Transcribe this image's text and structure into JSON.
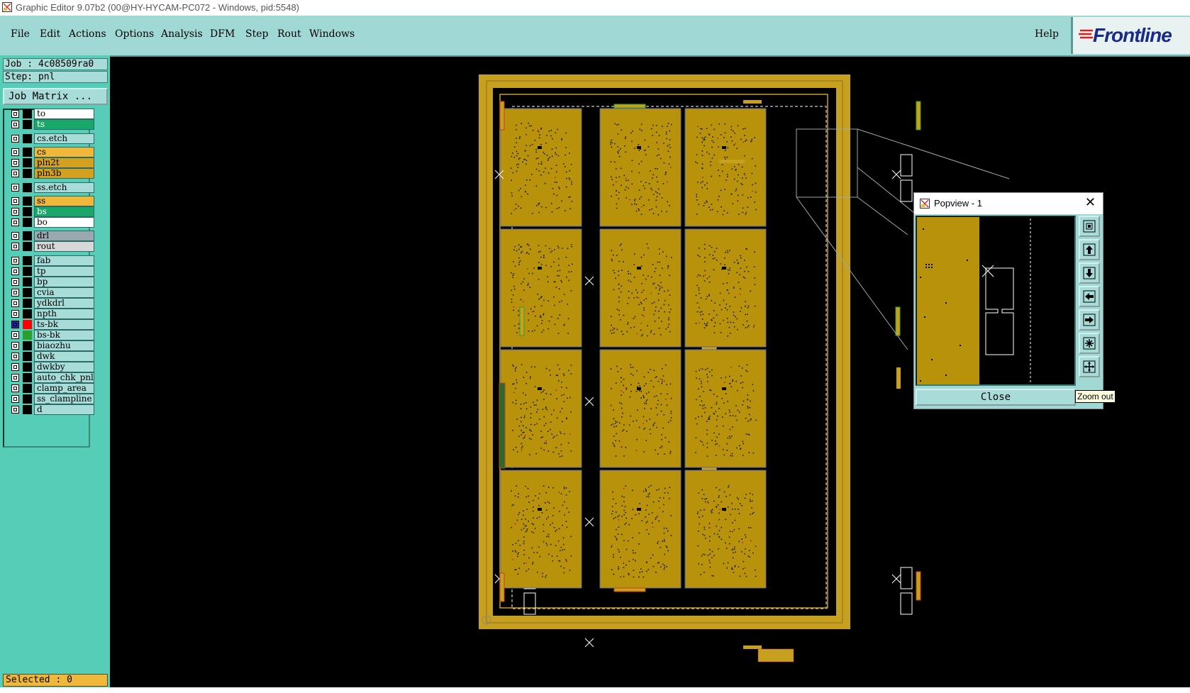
{
  "window": {
    "title": "Graphic Editor 9.07b2 (00@HY-HYCAM-PC072 - Windows, pid:5548)"
  },
  "menu": {
    "items": [
      "File",
      "Edit",
      "Actions",
      "Options",
      "Analysis",
      "DFM",
      "Step",
      "Rout",
      "Windows"
    ],
    "help": "Help"
  },
  "logo": {
    "text": "Frontline"
  },
  "job": {
    "job_label": "Job : 4c08509ra0",
    "step_label": "Step: pnl",
    "matrix_button": "Job Matrix ..."
  },
  "layers": [
    {
      "name": "to",
      "bg": "#ffffff",
      "fg": "#000000"
    },
    {
      "name": "ts",
      "bg": "#1aa86a",
      "fg": "#ffffff"
    },
    {
      "name": "cs.etch",
      "bg": "#a8dcd8",
      "fg": "#000000"
    },
    {
      "name": "cs",
      "bg": "#f0b83a",
      "fg": "#000000"
    },
    {
      "name": "pln2t",
      "bg": "#d4a020",
      "fg": "#000000"
    },
    {
      "name": "pln3b",
      "bg": "#d4a020",
      "fg": "#000000"
    },
    {
      "name": "ss.etch",
      "bg": "#a8dcd8",
      "fg": "#000000"
    },
    {
      "name": "ss",
      "bg": "#f0b83a",
      "fg": "#000000"
    },
    {
      "name": "bs",
      "bg": "#1aa86a",
      "fg": "#ffffff"
    },
    {
      "name": "bo",
      "bg": "#ffffff",
      "fg": "#000000"
    },
    {
      "name": "drl",
      "bg": "#9aa8b0",
      "fg": "#000000"
    },
    {
      "name": "rout",
      "bg": "#d8d8d8",
      "fg": "#000000"
    },
    {
      "name": "fab",
      "bg": "#a8dcd8",
      "fg": "#000000"
    },
    {
      "name": "tp",
      "bg": "#a8dcd8",
      "fg": "#000000"
    },
    {
      "name": "bp",
      "bg": "#a8dcd8",
      "fg": "#000000"
    },
    {
      "name": "cvia",
      "bg": "#a8dcd8",
      "fg": "#000000"
    },
    {
      "name": "ydkdrl",
      "bg": "#a8dcd8",
      "fg": "#000000"
    },
    {
      "name": "npth",
      "bg": "#a8dcd8",
      "fg": "#000000"
    },
    {
      "name": "ts-bk",
      "bg": "#a8dcd8",
      "fg": "#000000",
      "active_color": "#ff0000",
      "checked_color": "#1a2ab0"
    },
    {
      "name": "bs-bk",
      "bg": "#a8dcd8",
      "fg": "#000000",
      "active_color": "#2aa02a"
    },
    {
      "name": "biaozhu",
      "bg": "#a8dcd8",
      "fg": "#000000"
    },
    {
      "name": "dwk",
      "bg": "#a8dcd8",
      "fg": "#000000"
    },
    {
      "name": "dwkby",
      "bg": "#a8dcd8",
      "fg": "#000000"
    },
    {
      "name": "auto_chk_pnl",
      "bg": "#a8dcd8",
      "fg": "#000000"
    },
    {
      "name": "clamp_area",
      "bg": "#a8dcd8",
      "fg": "#000000"
    },
    {
      "name": "ss_clampline",
      "bg": "#a8dcd8",
      "fg": "#000000"
    },
    {
      "name": "d",
      "bg": "#a8dcd8",
      "fg": "#000000"
    }
  ],
  "status": {
    "selected": "Selected : 0"
  },
  "popview": {
    "title": "Popview - 1",
    "close_label": "Close",
    "tooltip": "Zoom out"
  },
  "colors": {
    "copper": "#b8920a",
    "board_border": "#c8a020",
    "menubar": "#9fd8d4",
    "panel": "#56cdb6"
  }
}
